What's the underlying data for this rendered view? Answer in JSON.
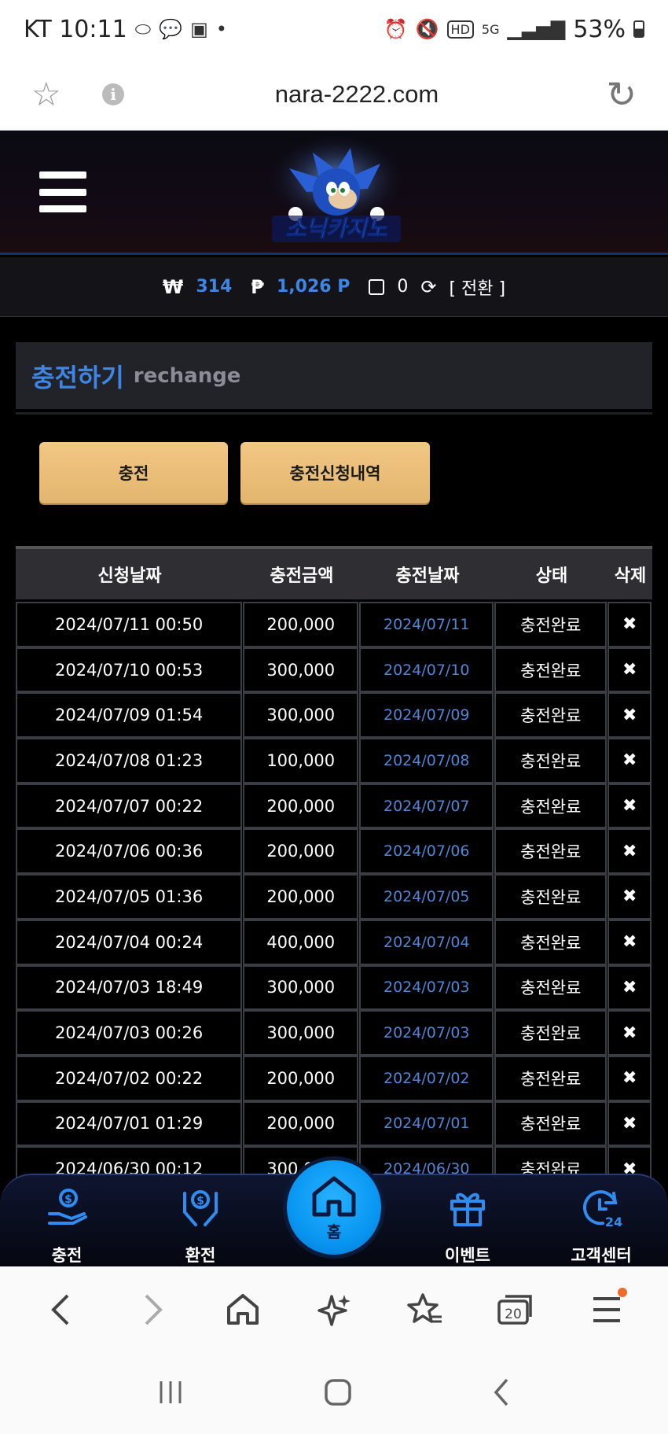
{
  "status_bar": {
    "carrier_time": "KT 10:11",
    "battery": "53%"
  },
  "browser": {
    "url": "nara-2222.com",
    "tab_count": "20"
  },
  "header": {
    "logo_text": "소닉카지노"
  },
  "balance": {
    "won_symbol": "₩",
    "won_value": "314",
    "point_symbol": "₱",
    "point_value": "1,026 P",
    "chip_value": "0",
    "convert_label": "[ 전환 ]"
  },
  "section": {
    "title_ko": "충전하기",
    "title_en": "rechange"
  },
  "buttons": {
    "charge": "충전",
    "history": "충전신청내역"
  },
  "table": {
    "headers": [
      "신청날짜",
      "충전금액",
      "충전날짜",
      "상태",
      "삭제"
    ],
    "rows": [
      {
        "req": "2024/07/11 00:50",
        "amount": "200,000",
        "date": "2024/07/11",
        "status": "충전완료",
        "del": "✖"
      },
      {
        "req": "2024/07/10 00:53",
        "amount": "300,000",
        "date": "2024/07/10",
        "status": "충전완료",
        "del": "✖"
      },
      {
        "req": "2024/07/09 01:54",
        "amount": "300,000",
        "date": "2024/07/09",
        "status": "충전완료",
        "del": "✖"
      },
      {
        "req": "2024/07/08 01:23",
        "amount": "100,000",
        "date": "2024/07/08",
        "status": "충전완료",
        "del": "✖"
      },
      {
        "req": "2024/07/07 00:22",
        "amount": "200,000",
        "date": "2024/07/07",
        "status": "충전완료",
        "del": "✖"
      },
      {
        "req": "2024/07/06 00:36",
        "amount": "200,000",
        "date": "2024/07/06",
        "status": "충전완료",
        "del": "✖"
      },
      {
        "req": "2024/07/05 01:36",
        "amount": "200,000",
        "date": "2024/07/05",
        "status": "충전완료",
        "del": "✖"
      },
      {
        "req": "2024/07/04 00:24",
        "amount": "400,000",
        "date": "2024/07/04",
        "status": "충전완료",
        "del": "✖"
      },
      {
        "req": "2024/07/03 18:49",
        "amount": "300,000",
        "date": "2024/07/03",
        "status": "충전완료",
        "del": "✖"
      },
      {
        "req": "2024/07/03 00:26",
        "amount": "300,000",
        "date": "2024/07/03",
        "status": "충전완료",
        "del": "✖"
      },
      {
        "req": "2024/07/02 00:22",
        "amount": "200,000",
        "date": "2024/07/02",
        "status": "충전완료",
        "del": "✖"
      },
      {
        "req": "2024/07/01 01:29",
        "amount": "200,000",
        "date": "2024/07/01",
        "status": "충전완료",
        "del": "✖"
      },
      {
        "req": "2024/06/30 00:12",
        "amount": "300,000",
        "date": "2024/06/30",
        "status": "충전완료",
        "del": "✖"
      }
    ]
  },
  "bottom_nav": {
    "charge": "충전",
    "exchange": "환전",
    "home": "홈",
    "event": "이벤트",
    "support": "고객센터"
  },
  "colors": {
    "accent_blue": "#3d86e6",
    "button_gold": "#e9bd74",
    "home_blue": "#0896f2"
  }
}
